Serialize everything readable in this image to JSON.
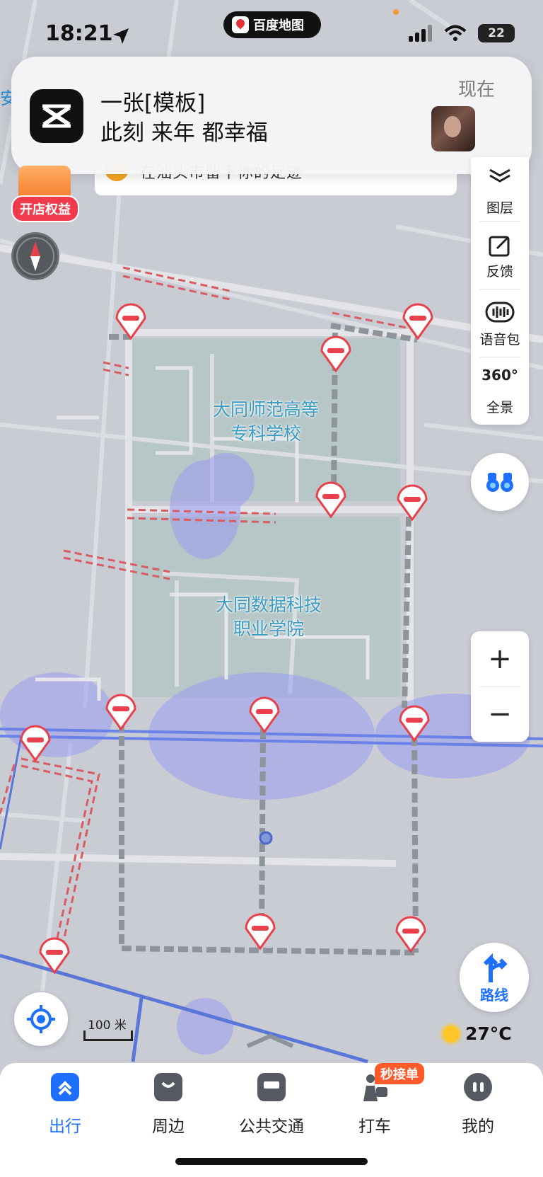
{
  "status_bar": {
    "time": "18:21",
    "battery": "22",
    "app_pill": "百度地图"
  },
  "notification": {
    "title": "一张[模板]",
    "body": "此刻 来年 都幸福",
    "time": "现在"
  },
  "tip_bar": {
    "text": "在汕头市留下你的足迹"
  },
  "promo": {
    "label": "开店权益",
    "side_text": "安 (J"
  },
  "map": {
    "labels": [
      "大同师范高等\n专科学校",
      "大同数据科技\n职业学院"
    ],
    "scale": "100 米"
  },
  "tools": [
    {
      "icon": "layers-icon",
      "label": "图层"
    },
    {
      "icon": "feedback-icon",
      "label": "反馈"
    },
    {
      "icon": "voice-pack-icon",
      "label": "语音包"
    },
    {
      "icon": "panorama-360-icon",
      "label": "全景"
    }
  ],
  "zoom": {
    "in": "+",
    "out": "−"
  },
  "route": {
    "label": "路线"
  },
  "weather": {
    "temp": "27°C"
  },
  "nav": [
    {
      "label": "出行",
      "active": true
    },
    {
      "label": "周边"
    },
    {
      "label": "公共交通"
    },
    {
      "label": "打车",
      "badge": "秒接单"
    },
    {
      "label": "我的"
    }
  ],
  "colors": {
    "accent": "#1f6fff",
    "closure_red": "#e8414b",
    "map_bg": "#c9cdd3"
  }
}
